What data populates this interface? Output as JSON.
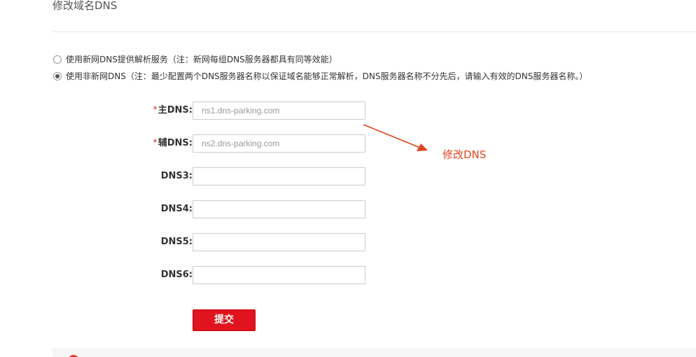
{
  "page_title": "修改域名DNS",
  "dns_mode": {
    "options": [
      {
        "label": "使用新网DNS提供解析服务（注：新网每组DNS服务器都具有同等效能）",
        "checked": false
      },
      {
        "label": "使用非新网DNS（注：最少配置两个DNS服务器名称以保证域名能够正常解析，DNS服务器名称不分先后，请输入有效的DNS服务器名称。）",
        "checked": true
      }
    ]
  },
  "fields": {
    "required_mark": "*",
    "primary": {
      "label": "主DNS:",
      "value": "",
      "placeholder": "ns1.dns-parking.com"
    },
    "secondary": {
      "label": "辅DNS:",
      "value": "",
      "placeholder": "ns2.dns-parking.com"
    },
    "dns3": {
      "label": "DNS3:",
      "value": "",
      "placeholder": ""
    },
    "dns4": {
      "label": "DNS4:",
      "value": "",
      "placeholder": ""
    },
    "dns5": {
      "label": "DNS5:",
      "value": "",
      "placeholder": ""
    },
    "dns6": {
      "label": "DNS6:",
      "value": "",
      "placeholder": ""
    }
  },
  "submit_label": "提交",
  "annotation": {
    "text": "修改DNS",
    "color": "#e0461e"
  },
  "colors": {
    "accent_red": "#e0131e",
    "required_star": "#e4393c"
  },
  "icons": {
    "warning": "warning-circle-icon",
    "annotation": "arrow-icon"
  }
}
